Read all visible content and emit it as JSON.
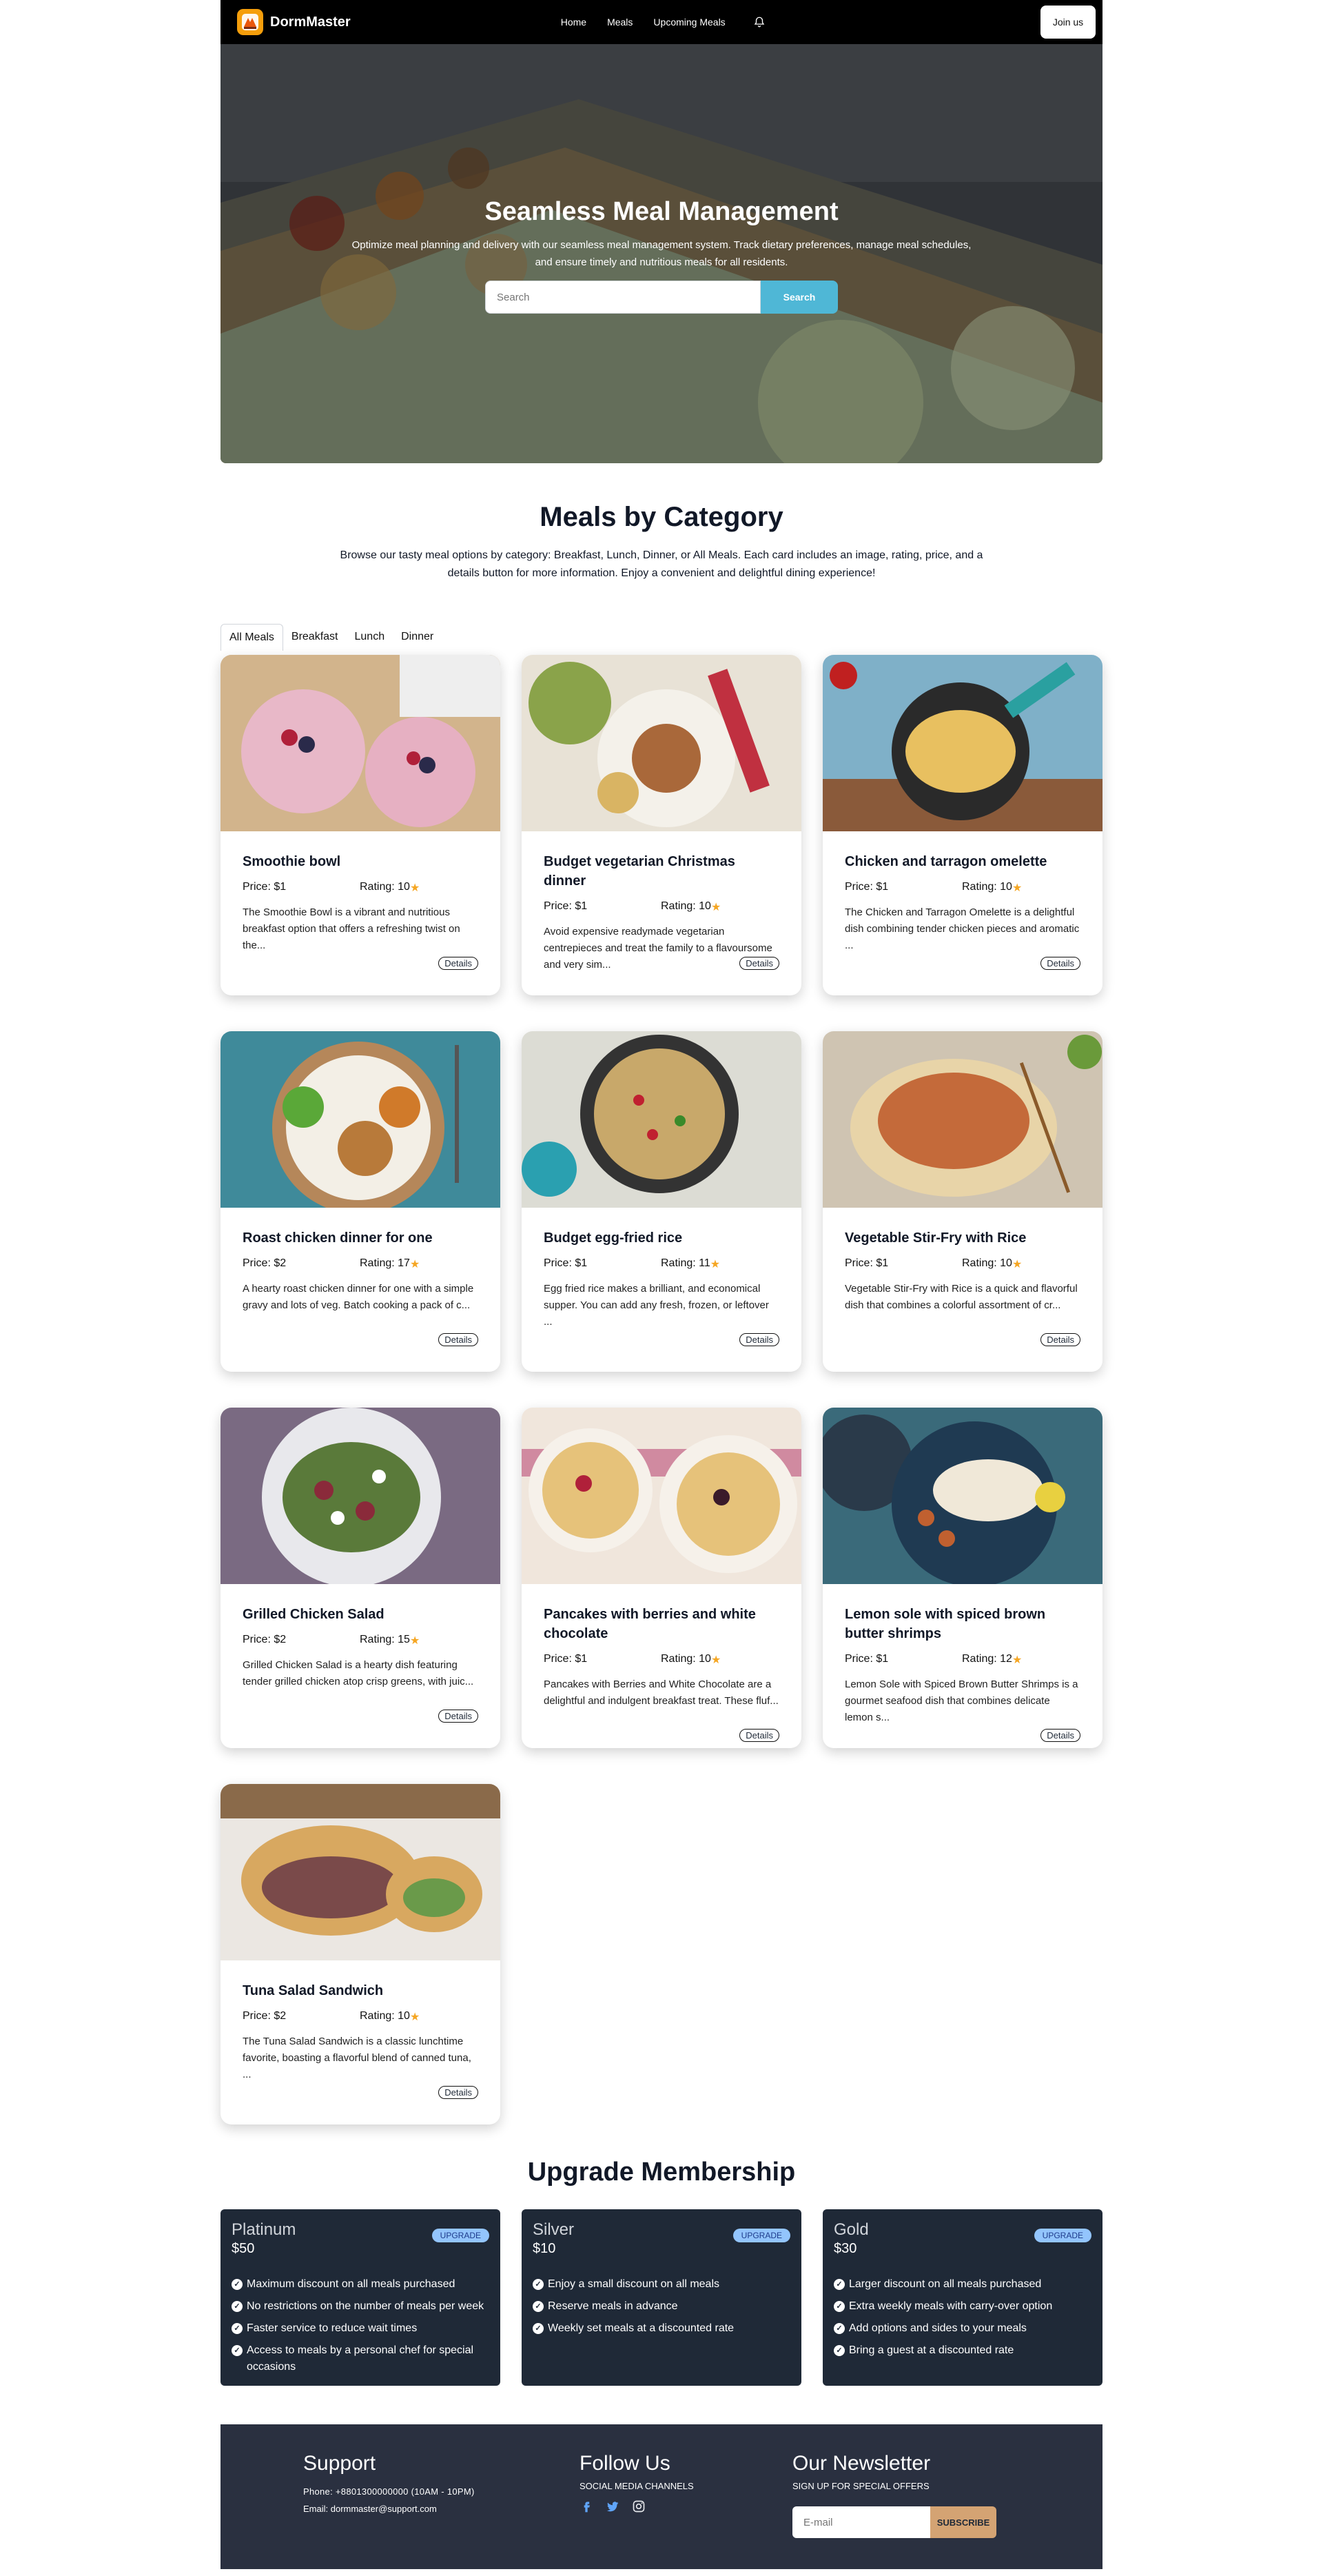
{
  "nav": {
    "brand": "DormMaster",
    "links": [
      "Home",
      "Meals",
      "Upcoming Meals"
    ],
    "join_label": "Join us"
  },
  "hero": {
    "title": "Seamless Meal Management",
    "subtitle": "Optimize meal planning and delivery with our seamless meal management system. Track dietary preferences, manage meal schedules, and ensure timely and nutritious meals for all residents.",
    "search_placeholder": "Search",
    "search_button": "Search"
  },
  "category": {
    "title": "Meals by Category",
    "description": "Browse our tasty meal options by category: Breakfast, Lunch, Dinner, or All Meals. Each card includes an image, rating, price, and a details button for more information. Enjoy a convenient and delightful dining experience!",
    "tabs": [
      "All Meals",
      "Breakfast",
      "Lunch",
      "Dinner"
    ],
    "active_tab": "All Meals"
  },
  "meals": [
    {
      "title": "Smoothie bowl",
      "price": "Price: $1",
      "rating": "Rating: 10",
      "desc": "The Smoothie Bowl is a vibrant and nutritious breakfast option that offers a refreshing twist on the...",
      "details": "Details"
    },
    {
      "title": "Budget vegetarian Christmas dinner",
      "price": "Price: $1",
      "rating": "Rating: 10",
      "desc": "Avoid expensive readymade vegetarian centrepieces and treat the family to a flavoursome and very sim...",
      "details": "Details"
    },
    {
      "title": "Chicken and tarragon omelette",
      "price": "Price: $1",
      "rating": "Rating: 10",
      "desc": "The Chicken and Tarragon Omelette is a delightful dish combining tender chicken pieces and aromatic ...",
      "details": "Details"
    },
    {
      "title": "Roast chicken dinner for one",
      "price": "Price: $2",
      "rating": "Rating: 17",
      "desc": "A hearty roast chicken dinner for one with a simple gravy and lots of veg. Batch cooking a pack of c...",
      "details": "Details"
    },
    {
      "title": "Budget egg-fried rice",
      "price": "Price: $1",
      "rating": "Rating: 11",
      "desc": "Egg fried rice makes a brilliant, and economical supper. You can add any fresh, frozen, or leftover ...",
      "details": "Details"
    },
    {
      "title": "Vegetable Stir-Fry with Rice",
      "price": "Price: $1",
      "rating": "Rating: 10",
      "desc": "Vegetable Stir-Fry with Rice is a quick and flavorful dish that combines a colorful assortment of cr...",
      "details": "Details"
    },
    {
      "title": "Grilled Chicken Salad",
      "price": "Price: $2",
      "rating": "Rating: 15",
      "desc": "Grilled Chicken Salad is a hearty dish featuring tender grilled chicken atop crisp greens, with juic...",
      "details": "Details"
    },
    {
      "title": "Pancakes with berries and white chocolate",
      "price": "Price: $1",
      "rating": "Rating: 10",
      "desc": "Pancakes with Berries and White Chocolate are a delightful and indulgent breakfast treat. These fluf...",
      "details": "Details"
    },
    {
      "title": "Lemon sole with spiced brown butter shrimps",
      "price": "Price: $1",
      "rating": "Rating: 12",
      "desc": "Lemon Sole with Spiced Brown Butter Shrimps is a gourmet seafood dish that combines delicate lemon s...",
      "details": "Details"
    },
    {
      "title": "Tuna Salad Sandwich",
      "price": "Price: $2",
      "rating": "Rating: 10",
      "desc": "The Tuna Salad Sandwich is a classic lunchtime favorite, boasting a flavorful blend of canned tuna, ...",
      "details": "Details"
    }
  ],
  "membership": {
    "title": "Upgrade Membership",
    "upgrade_label": "UPGRADE",
    "plans": [
      {
        "name": "Platinum",
        "price": "$50",
        "features": [
          "Maximum discount on all meals purchased",
          "No restrictions on the number of meals per week",
          "Faster service to reduce wait times",
          "Access to meals by a personal chef for special occasions"
        ]
      },
      {
        "name": "Silver",
        "price": "$10",
        "features": [
          "Enjoy a small discount on all meals",
          "Reserve meals in advance",
          "Weekly set meals at a discounted rate"
        ]
      },
      {
        "name": "Gold",
        "price": "$30",
        "features": [
          "Larger discount on all meals purchased",
          "Extra weekly meals with carry-over option",
          "Add options and sides to your meals",
          "Bring a guest at a discounted rate"
        ]
      }
    ]
  },
  "footer": {
    "support_title": "Support",
    "phone": "Phone: +8801300000000 (10AM - 10PM)",
    "email": "Email: dormmaster@support.com",
    "follow_title": "Follow Us",
    "follow_sub": "SOCIAL MEDIA CHANNELS",
    "newsletter_title": "Our Newsletter",
    "newsletter_sub": "SIGN UP FOR SPECIAL OFFERS",
    "email_placeholder": "E-mail",
    "subscribe_label": "SUBSCRIBE"
  },
  "colors": {
    "accent": "#4fb7d6",
    "dark_panel": "#1f2937",
    "footer_bg": "#2a3040",
    "star": "#f5a623",
    "subscribe": "#d4a373"
  },
  "icons": [
    "bell-icon",
    "star-icon",
    "check-icon",
    "facebook-icon",
    "twitter-icon",
    "instagram-icon"
  ]
}
